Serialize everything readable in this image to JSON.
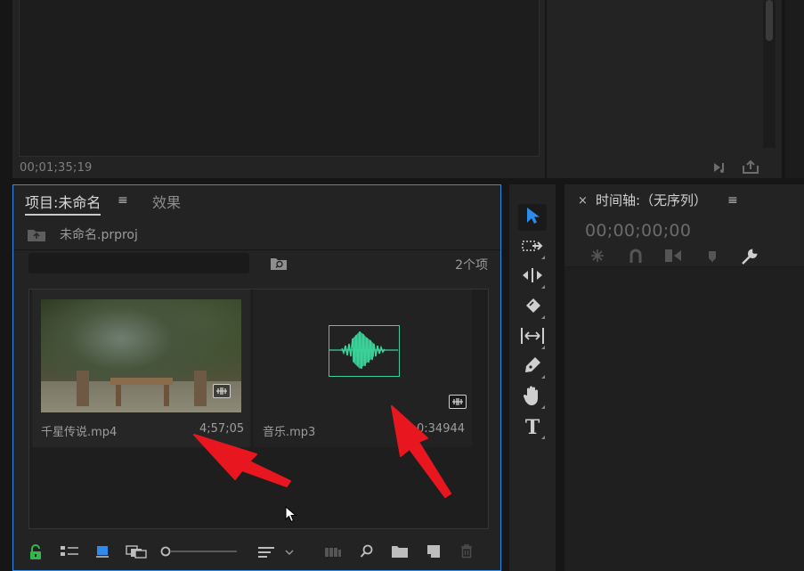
{
  "program_monitor": {
    "timecode": "00;01;35;19"
  },
  "project_panel": {
    "tab_project": "项目:未命名",
    "tab_menu": "≡",
    "tab_effects": "效果",
    "bin_name": "未命名.prproj",
    "search_value": "",
    "item_count": "2个项",
    "items": [
      {
        "name": "千星传说.mp4",
        "duration": "4;57;05"
      },
      {
        "name": "音乐.mp3",
        "duration": "0:34944"
      }
    ]
  },
  "timeline_panel": {
    "close": "×",
    "title": "时间轴:（无序列）",
    "menu": "≡",
    "timecode": "00;00;00;00"
  },
  "tools": {
    "type_tool": "T"
  },
  "colors": {
    "accent_blue": "#2d8ceb",
    "waveform_green": "#3bd29a",
    "annotation_red": "#e8171f",
    "lock_green": "#2fb94a"
  },
  "icons": {
    "tools": [
      "selection-tool-icon",
      "track-select-tool-icon",
      "ripple-edit-tool-icon",
      "razor-tool-icon",
      "slip-tool-icon",
      "pen-tool-icon",
      "hand-tool-icon",
      "type-tool-icon"
    ],
    "project_toolbar": [
      "lock-icon",
      "list-view-icon",
      "icon-view-icon",
      "freeform-view-icon",
      "zoom-slider",
      "sort-icon",
      "automate-to-sequence-icon",
      "find-icon",
      "new-bin-icon",
      "new-item-icon",
      "trash-icon"
    ]
  }
}
